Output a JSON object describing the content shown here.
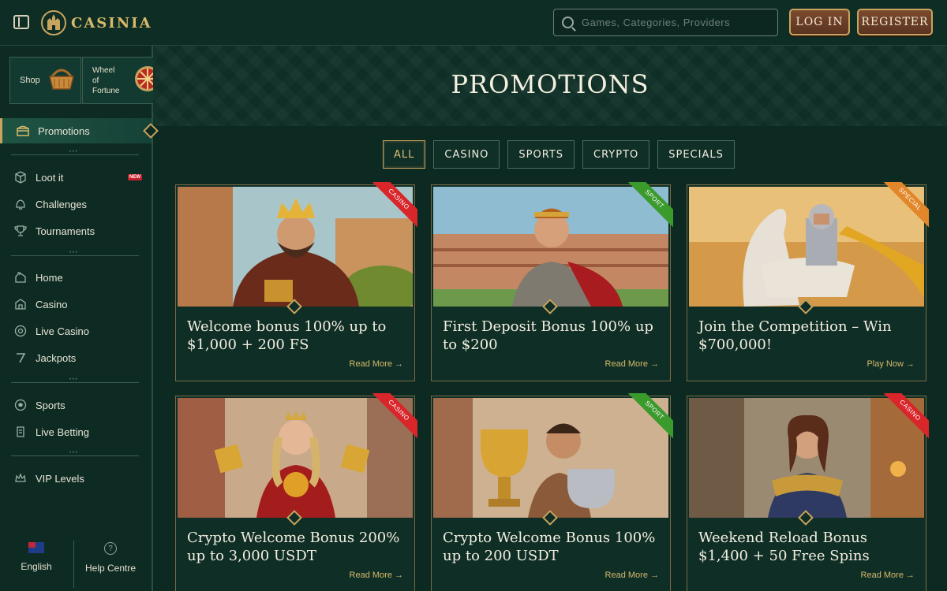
{
  "header": {
    "brand": "CASINIA",
    "search_placeholder": "Games, Categories, Providers",
    "login_label": "LOG IN",
    "register_label": "REGISTER"
  },
  "sidebar": {
    "quick_tiles": [
      {
        "label": "Shop"
      },
      {
        "label": "Wheel\nof\nFortune"
      }
    ],
    "items": [
      {
        "label": "Promotions",
        "icon": "chest-icon",
        "active": true
      },
      {
        "label": "Loot it",
        "icon": "box-icon",
        "badge": "NEW"
      },
      {
        "label": "Challenges",
        "icon": "bell-icon"
      },
      {
        "label": "Tournaments",
        "icon": "trophy-icon"
      },
      {
        "label": "Home",
        "icon": "home-icon"
      },
      {
        "label": "Casino",
        "icon": "casino-icon"
      },
      {
        "label": "Live Casino",
        "icon": "roulette-icon"
      },
      {
        "label": "Jackpots",
        "icon": "seven-icon"
      },
      {
        "label": "Sports",
        "icon": "ball-icon"
      },
      {
        "label": "Live Betting",
        "icon": "live-icon"
      },
      {
        "label": "VIP Levels",
        "icon": "crown-icon"
      }
    ],
    "footer": {
      "language_label": "English",
      "help_label": "Help Centre"
    }
  },
  "main": {
    "title": "PROMOTIONS",
    "filters": [
      "ALL",
      "CASINO",
      "SPORTS",
      "CRYPTO",
      "SPECIALS"
    ],
    "active_filter": "ALL",
    "cards": [
      {
        "title": "Welcome bonus 100% up to $1,000 + 200 FS",
        "tag": "CASINO",
        "link": "Read More →"
      },
      {
        "title": "First Deposit Bonus 100% up to $200",
        "tag": "SPORT",
        "link": "Read More →"
      },
      {
        "title": "Join the Competition – Win $700,000!",
        "tag": "SPECIAL",
        "link": "Play Now →"
      },
      {
        "title": "Crypto Welcome Bonus 200% up to 3,000 USDT",
        "tag": "CASINO",
        "link": "Read More →"
      },
      {
        "title": "Crypto Welcome Bonus 100% up to 200 USDT",
        "tag": "SPORT",
        "link": "Read More →"
      },
      {
        "title": "Weekend Reload Bonus $1,400 + 50 Free Spins",
        "tag": "CASINO",
        "link": "Read More →"
      }
    ]
  },
  "colors": {
    "background": "#0c2a22",
    "gold_accent": "#c9a45e",
    "casino_ribbon": "#d8262b",
    "sport_ribbon": "#3a9a2c",
    "special_ribbon": "#e2862a"
  }
}
